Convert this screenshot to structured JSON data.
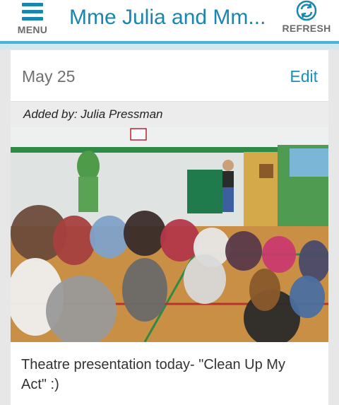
{
  "header": {
    "menu_label": "MENU",
    "title": "Mme Julia and Mm...",
    "refresh_label": "REFRESH"
  },
  "post": {
    "date": "May 25",
    "edit_label": "Edit",
    "added_by": "Added by: Julia Pressman",
    "photo_description_icon": "photo",
    "caption": "Theatre presentation today- \"Clean Up My Act\" :)"
  },
  "colors": {
    "accent": "#1a86b0",
    "header_border": "#4db3d6",
    "background": "#e7e7e7"
  }
}
